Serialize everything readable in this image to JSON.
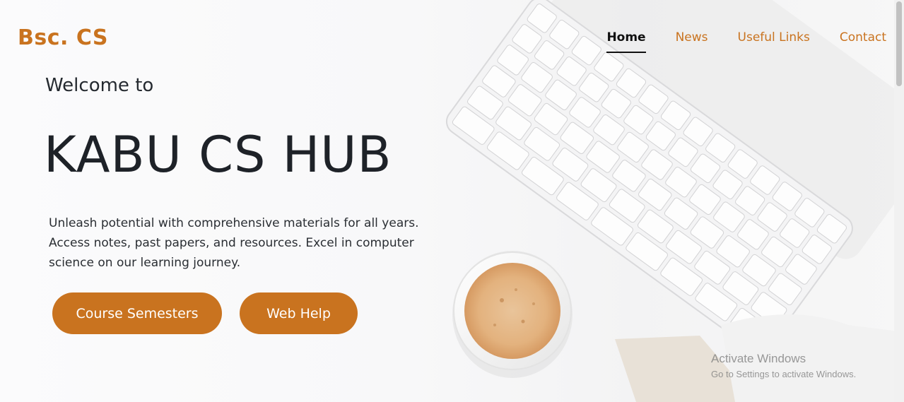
{
  "brand": "Bsc. CS",
  "nav": {
    "items": [
      {
        "label": "Home",
        "active": true
      },
      {
        "label": "News",
        "active": false
      },
      {
        "label": "Useful Links",
        "active": false
      },
      {
        "label": "Contact",
        "active": false
      }
    ]
  },
  "hero": {
    "welcome": "Welcome to",
    "title": "KABU CS HUB",
    "description": "Unleash potential with comprehensive materials for all years. Access notes, past papers, and resources. Excel in computer science on our learning journey.",
    "buttons": {
      "course_semesters": "Course Semesters",
      "web_help": "Web Help"
    }
  },
  "watermark": {
    "title": "Activate Windows",
    "subtitle": "Go to Settings to activate Windows."
  },
  "colors": {
    "accent": "#c9731f",
    "text_dark": "#1e2228"
  }
}
